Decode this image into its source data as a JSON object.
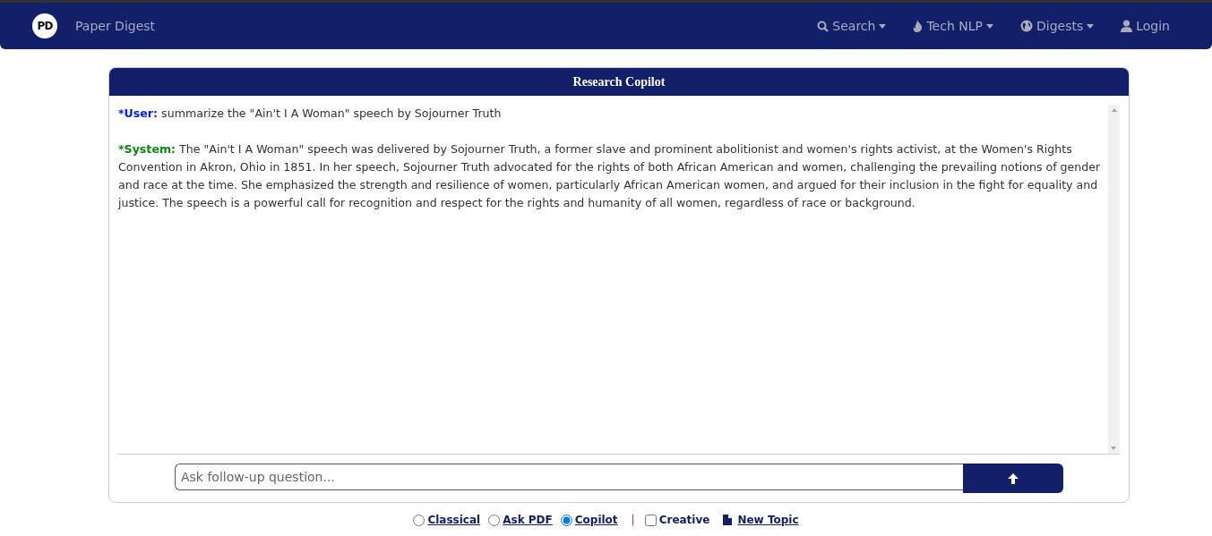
{
  "navbar": {
    "logo": "PD",
    "brand": "Paper Digest",
    "menu": [
      {
        "label": "Search",
        "kind": "dropdown"
      },
      {
        "label": "Tech NLP",
        "kind": "dropdown"
      },
      {
        "label": "Digests",
        "kind": "dropdown"
      },
      {
        "label": "Login",
        "kind": "link"
      }
    ]
  },
  "chat": {
    "title": "Research Copilot",
    "messages": [
      {
        "kind": "user",
        "speaker": "*User:",
        "text": "summarize the \"Ain't I A Woman\" speech by Sojourner Truth"
      },
      {
        "kind": "system",
        "speaker": "*System:",
        "text": "The \"Ain't I A Woman\" speech was delivered by Sojourner Truth, a former slave and prominent abolitionist and women's rights activist, at the Women's Rights Convention in Akron, Ohio in 1851. In her speech, Sojourner Truth advocated for the rights of both African American and women, challenging the prevailing notions of gender and race at the time. She emphasized the strength and resilience of women, particularly African American women, and argued for their inclusion in the fight for equality and justice. The speech is a powerful call for recognition and respect for the rights and humanity of all women, regardless of race or background."
      }
    ],
    "input": {
      "placeholder": "Ask follow-up question..."
    }
  },
  "options": [
    {
      "kind": "radio",
      "label": "Classical",
      "selected": false
    },
    {
      "kind": "radio",
      "label": "Ask PDF",
      "selected": false
    },
    {
      "kind": "radio",
      "label": "Copilot",
      "selected": true
    },
    {
      "kind": "separator",
      "label": "|"
    },
    {
      "kind": "checkbox",
      "label": "Creative",
      "checked": false
    },
    {
      "kind": "action",
      "label": "New Topic"
    }
  ]
}
